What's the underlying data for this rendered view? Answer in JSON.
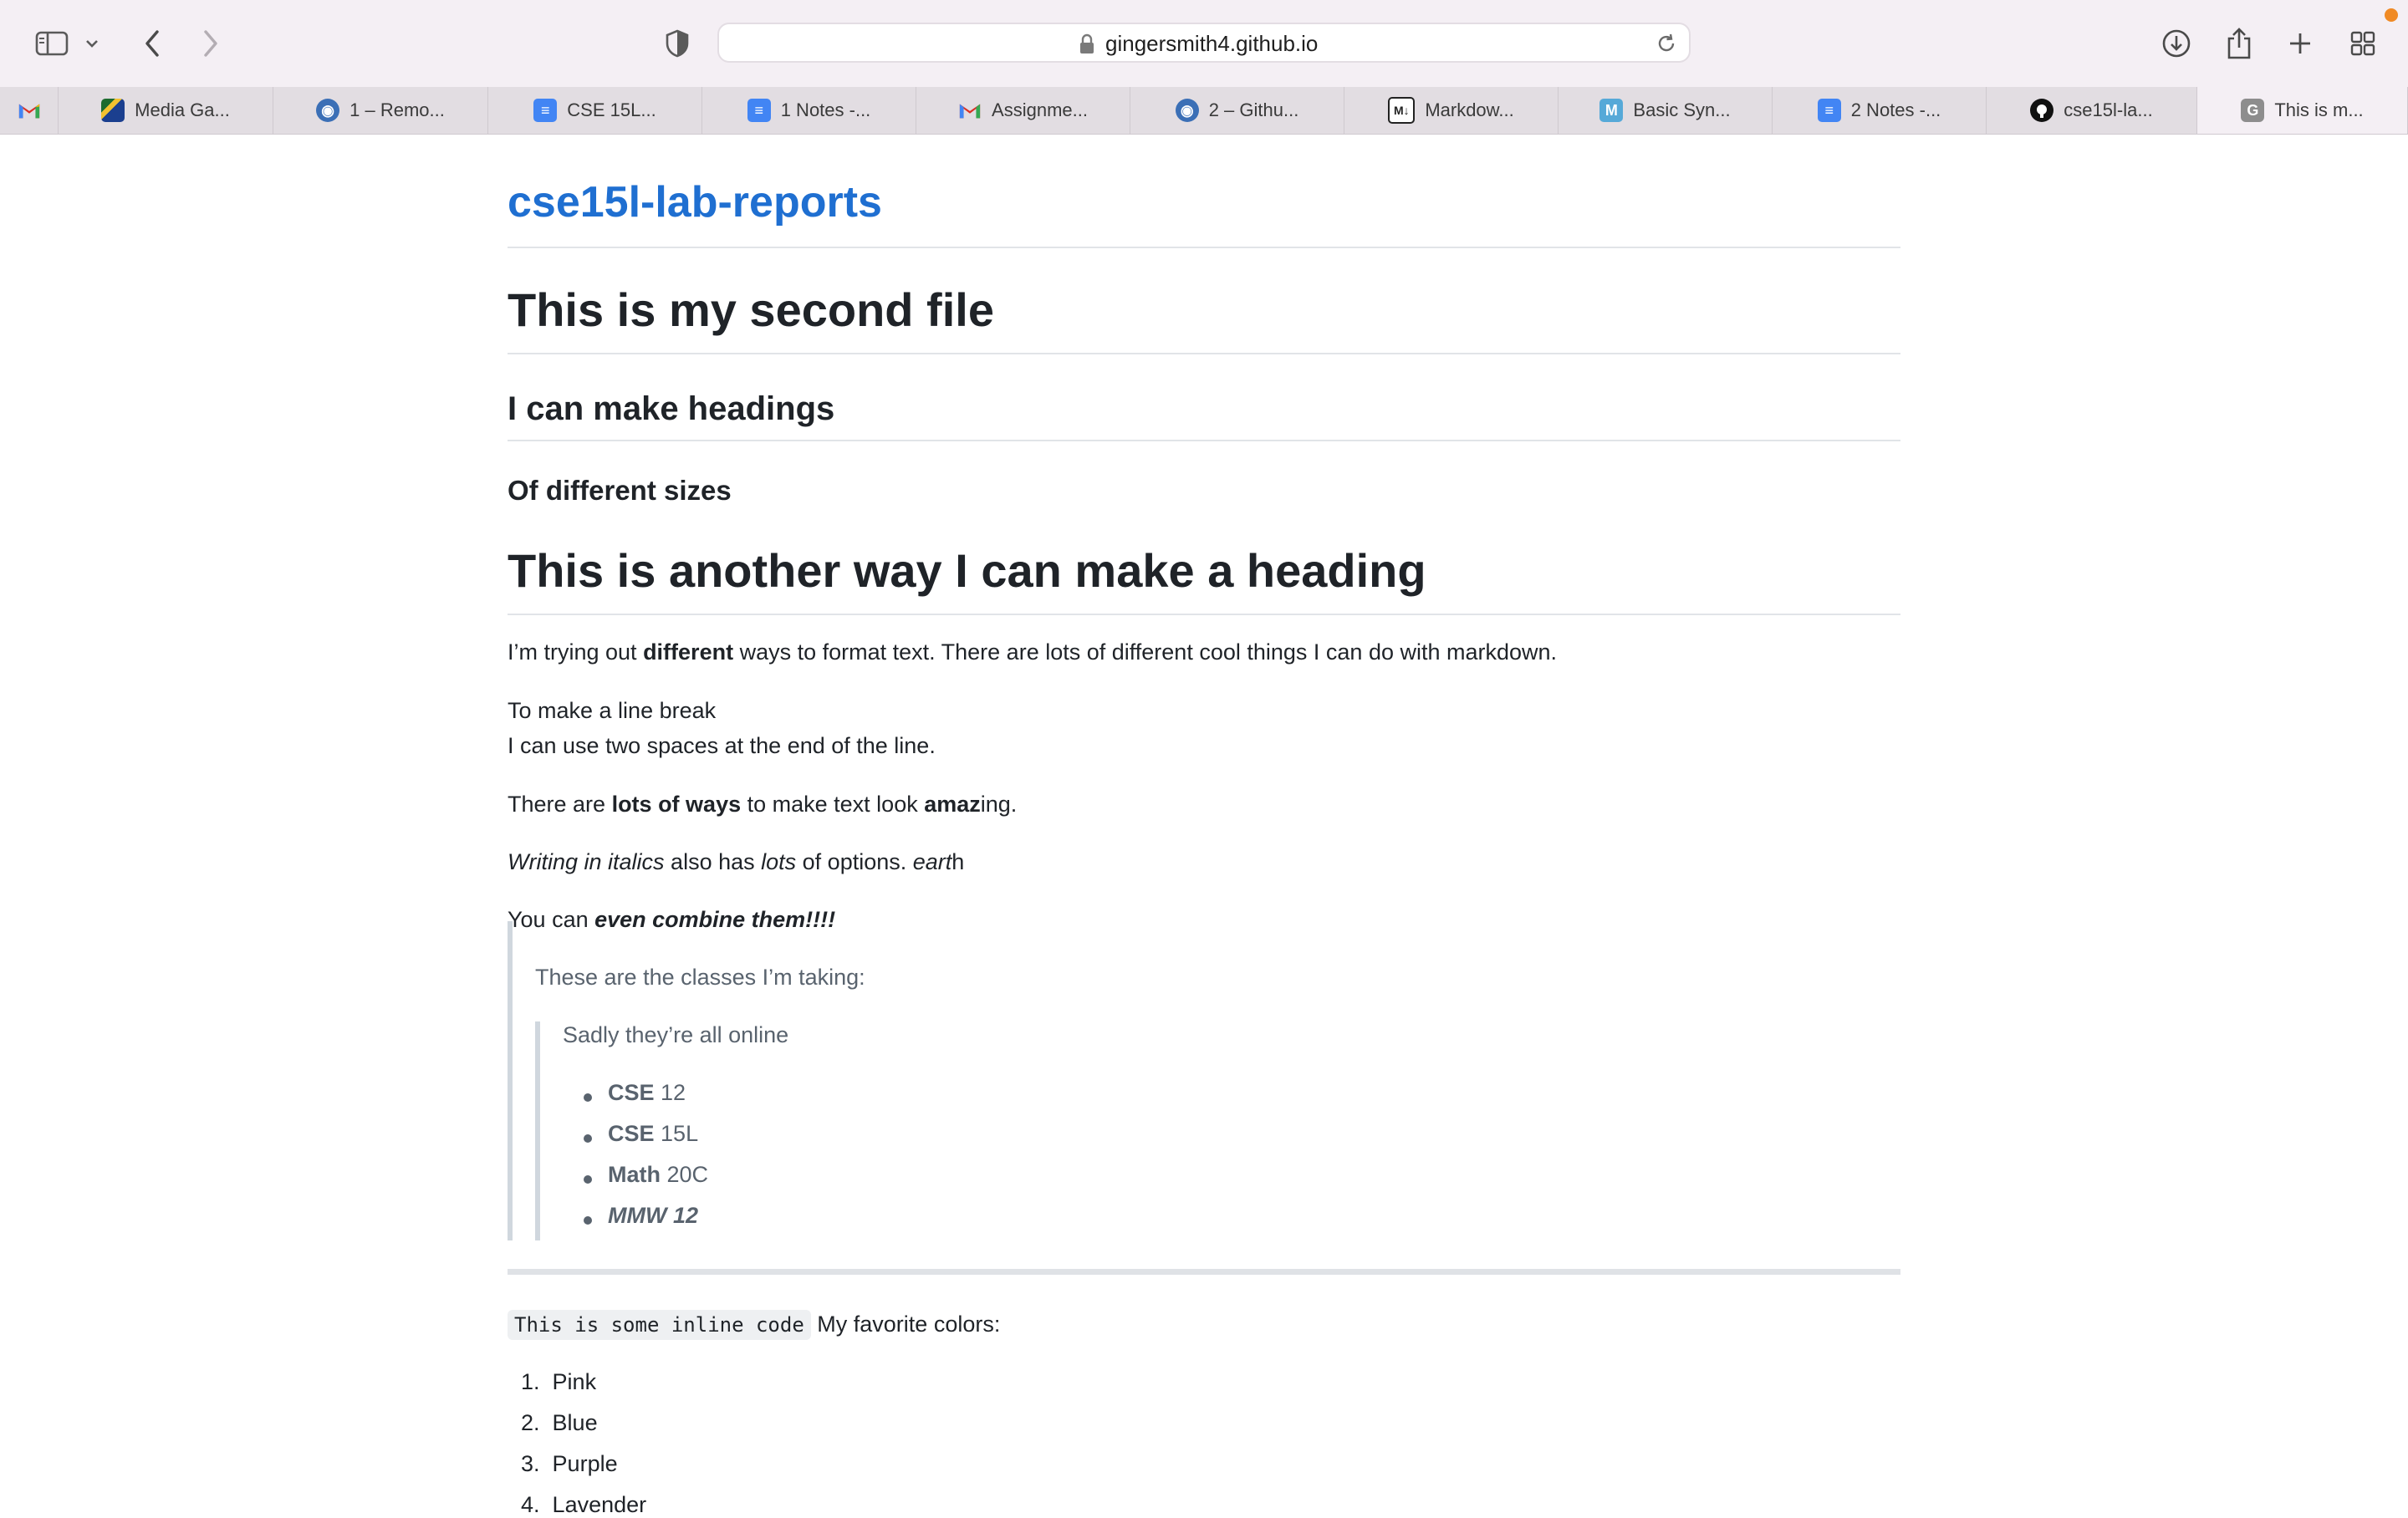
{
  "browser": {
    "url": "gingersmith4.github.io",
    "tabs": [
      {
        "label": "",
        "icon": "gmail-icon"
      },
      {
        "label": "Media Ga...",
        "icon": "media-gallery-icon"
      },
      {
        "label": "1 – Remo...",
        "icon": "remote-icon"
      },
      {
        "label": "CSE 15L...",
        "icon": "google-docs-icon"
      },
      {
        "label": "1 Notes -...",
        "icon": "google-docs-icon"
      },
      {
        "label": "Assignme...",
        "icon": "gmail-icon"
      },
      {
        "label": "2 – Githu...",
        "icon": "remote-icon"
      },
      {
        "label": "Markdow...",
        "icon": "markdown-icon"
      },
      {
        "label": "Basic Syn...",
        "icon": "markdown-guide-icon"
      },
      {
        "label": "2 Notes -...",
        "icon": "google-docs-icon"
      },
      {
        "label": "cse15l-la...",
        "icon": "github-icon"
      },
      {
        "label": "This is m...",
        "icon": "generic-g-icon"
      }
    ],
    "active_tab_index": 11,
    "colors": {
      "toolbar": "#f4eff4",
      "tabbar": "#e2dde2",
      "notification_dot": "#f08a24"
    }
  },
  "page": {
    "site_title": "cse15l-lab-reports",
    "h1_second_file": "This is my second file",
    "h2_headings": "I can make headings",
    "h3_sizes": "Of different sizes",
    "h1_another": "This is another way I can make a heading",
    "para1": {
      "before": "I’m trying out ",
      "bold": "different",
      "after": " ways to format text. There are lots of different cool things I can do with markdown."
    },
    "line_break_1": "To make a line break",
    "line_break_2": "I can use two spaces at the end of the line.",
    "para_ways": {
      "a": "There are ",
      "b_bold": "lots of ways",
      "c": " to make text look ",
      "d_bold": "amaz",
      "e": "ing."
    },
    "para_italics": {
      "a_italic": "Writing in italics",
      "b": " also has ",
      "c_italic": "lots",
      "d": " of options. ",
      "e_italic": "eart",
      "f": "h"
    },
    "para_combine": {
      "a": "You can ",
      "b_bold_italic": "even combine them!!!!"
    },
    "blockquote": {
      "line": "These are the classes I’m taking:",
      "nested_line": "Sadly they’re all online",
      "classes": [
        {
          "bold": "CSE",
          "rest": " 12",
          "italic": false
        },
        {
          "bold": "CSE",
          "rest": " 15L",
          "italic": false
        },
        {
          "bold": "Math",
          "rest": " 20C",
          "italic": false
        },
        {
          "bold": "MMW 12",
          "rest": "",
          "italic": true
        }
      ]
    },
    "inline_code": "This is some inline code",
    "favorite_colors_label": " My favorite colors:",
    "colors_list": [
      {
        "num": "1.",
        "label": "Pink"
      },
      {
        "num": "2.",
        "label": "Blue"
      },
      {
        "num": "3.",
        "label": "Purple"
      },
      {
        "num": "4.",
        "label": "Lavender"
      }
    ],
    "colors": {
      "title_link": "#1f6fd1",
      "text": "#1f2328",
      "muted": "#59636e",
      "rule": "#e1e4e8"
    }
  }
}
